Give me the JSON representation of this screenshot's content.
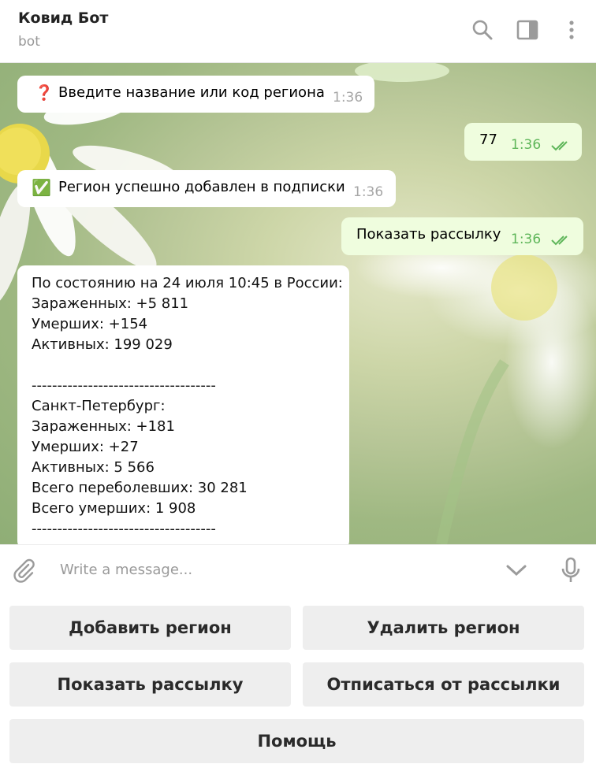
{
  "header": {
    "title": "Ковид Бот",
    "subtitle": "bot",
    "icons": [
      "search-icon",
      "sidebar-toggle-icon",
      "more-vertical-icon"
    ]
  },
  "messages": [
    {
      "direction": "in",
      "emoji": "❓",
      "text": "Введите название или код региона",
      "time": "1:36"
    },
    {
      "direction": "out",
      "text": "77",
      "time": "1:36",
      "status": "read"
    },
    {
      "direction": "in",
      "emoji": "✅",
      "text": "Регион успешно добавлен в подписки",
      "time": "1:36"
    },
    {
      "direction": "out",
      "text": "Показать рассылку",
      "time": "1:36",
      "status": "read"
    }
  ],
  "stats_message": {
    "text": "По состоянию на 24 июля 10:45 в России:\nЗараженных: +5 811\nУмерших: +154\nАктивных: 199 029\n\n------------------------------------\nСанкт-Петербург:\nЗараженных: +181\nУмерших: +27\nАктивных: 5 566\nВсего переболевших: 30 281\nВсего умерших: 1 908\n------------------------------------"
  },
  "input": {
    "placeholder": "Write a message..."
  },
  "keyboard": {
    "add_region": "Добавить регион",
    "remove_region": "Удалить регион",
    "show_newsletter": "Показать рассылку",
    "unsubscribe": "Отписаться от рассылки",
    "help": "Помощь"
  },
  "colors": {
    "outgoing_bubble": "#effdde",
    "incoming_bubble": "#ffffff",
    "read_check": "#5fb65a",
    "keyboard_button": "#eeeeee"
  }
}
